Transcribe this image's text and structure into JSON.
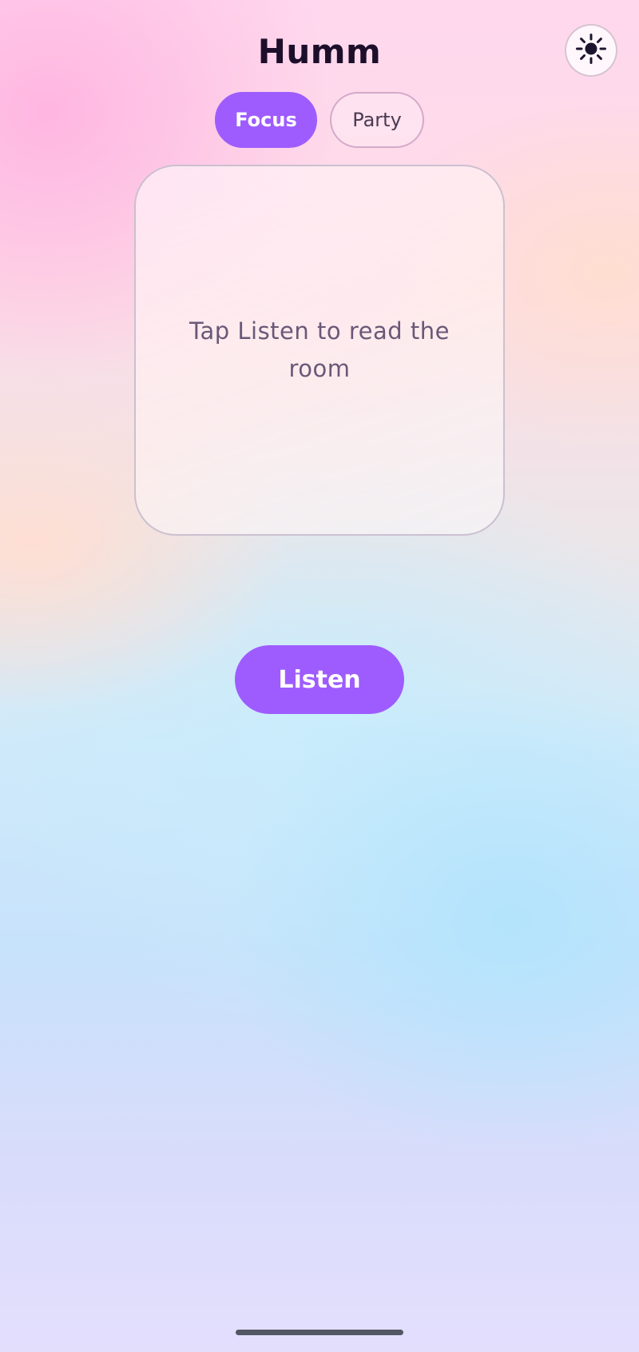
{
  "header": {
    "title": "Humm",
    "theme_toggle_icon": "sun-icon"
  },
  "mode_tabs": [
    {
      "label": "Focus",
      "selected": true
    },
    {
      "label": "Party",
      "selected": false
    }
  ],
  "card": {
    "message": "Tap Listen to read the room"
  },
  "actions": {
    "listen_label": "Listen"
  },
  "colors": {
    "accent": "#9e5cff",
    "title": "#1d0f2b",
    "muted_text": "#6a5878"
  }
}
